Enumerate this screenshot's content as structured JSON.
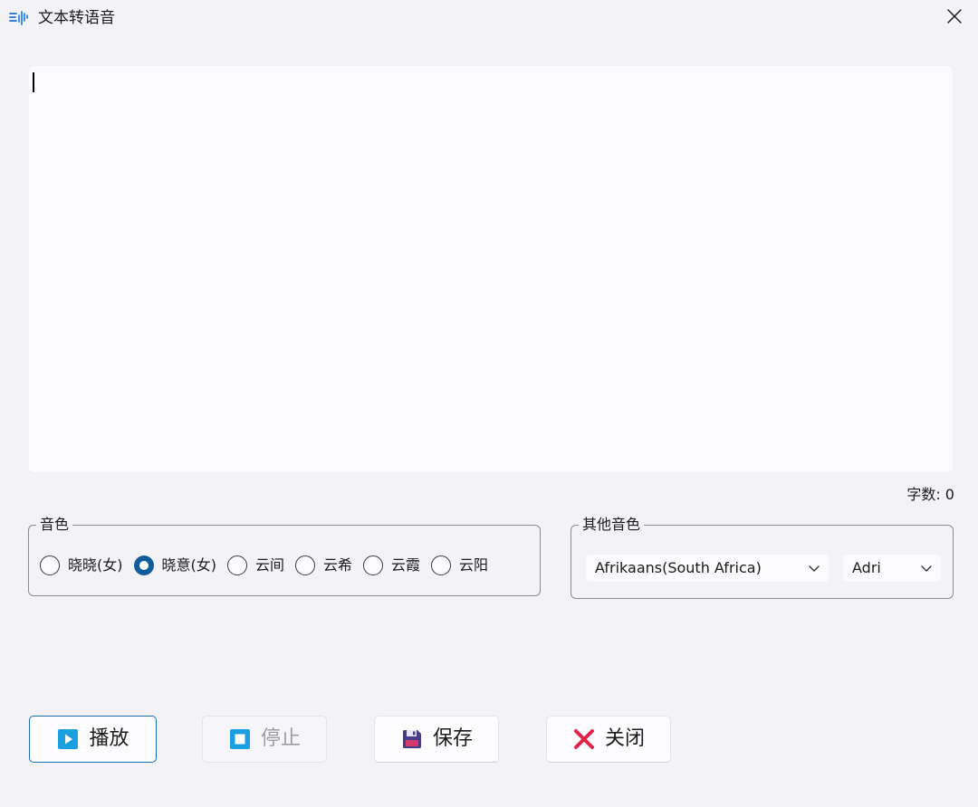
{
  "window": {
    "title": "文本转语音",
    "app_icon": "audio-wave-icon",
    "close_icon": "close-icon"
  },
  "editor": {
    "value": "",
    "placeholder": ""
  },
  "status": {
    "char_count": "字数: 0"
  },
  "voice_group": {
    "title": "音色",
    "options": [
      {
        "label": "晓晓(女)",
        "checked": false
      },
      {
        "label": "晓意(女)",
        "checked": true
      },
      {
        "label": "云间",
        "checked": false
      },
      {
        "label": "云希",
        "checked": false
      },
      {
        "label": "云霞",
        "checked": false
      },
      {
        "label": "云阳",
        "checked": false
      }
    ]
  },
  "other_group": {
    "title": "其他音色",
    "language_selected": "Afrikaans(South Africa)",
    "voice_selected": "Adri"
  },
  "buttons": {
    "play": {
      "label": "播放",
      "icon": "play-icon",
      "enabled": true
    },
    "stop": {
      "label": "停止",
      "icon": "stop-icon",
      "enabled": false
    },
    "save": {
      "label": "保存",
      "icon": "floppy-disk-icon",
      "enabled": true
    },
    "close": {
      "label": "关闭",
      "icon": "close-x-icon",
      "enabled": true
    }
  },
  "colors": {
    "accent": "#1a6fb5",
    "radio_checked": "#0f5d99",
    "close_red": "#e0244a",
    "play_blue": "#1aa0e0"
  }
}
